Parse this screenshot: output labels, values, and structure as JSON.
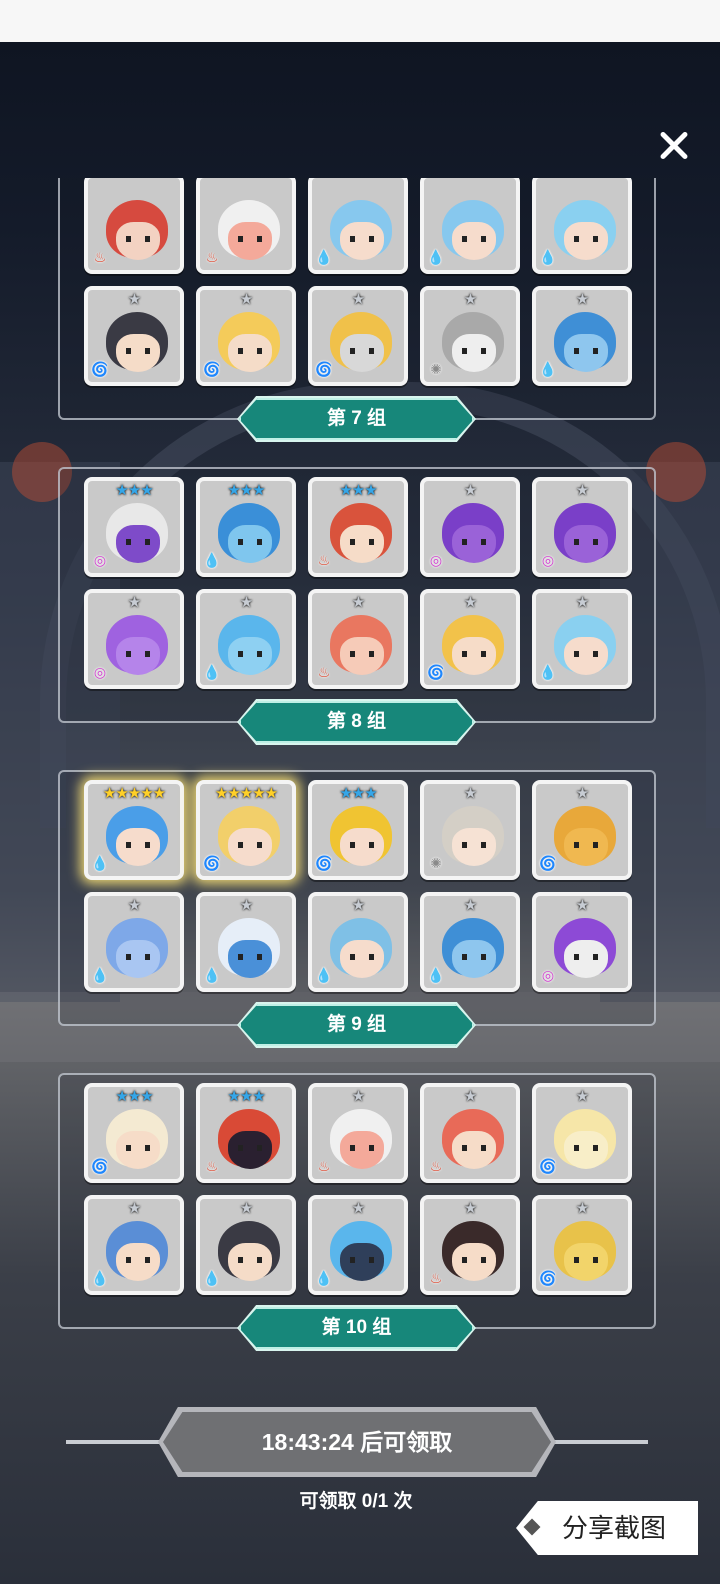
{
  "groups": [
    {
      "label": "第 7 组",
      "heroes": [
        {
          "stars": "",
          "tier": "grey",
          "element": "fire",
          "hair": "#d64a3f",
          "skin": "#f3d2c2"
        },
        {
          "stars": "",
          "tier": "grey",
          "element": "fire",
          "hair": "#f0f0f0",
          "skin": "#f4a99a"
        },
        {
          "stars": "",
          "tier": "grey",
          "element": "water",
          "hair": "#87c8ee",
          "skin": "#f6dccc"
        },
        {
          "stars": "",
          "tier": "grey",
          "element": "water",
          "hair": "#87c8ee",
          "skin": "#f6dccc"
        },
        {
          "stars": "",
          "tier": "grey",
          "element": "water",
          "hair": "#8ad0f0",
          "skin": "#f6dccc"
        },
        {
          "stars": "★",
          "tier": "grey",
          "element": "wind",
          "hair": "#3a3a44",
          "skin": "#f5dcc8"
        },
        {
          "stars": "★",
          "tier": "grey",
          "element": "wind",
          "hair": "#f4cb5a",
          "skin": "#f5dcc8"
        },
        {
          "stars": "★",
          "tier": "grey",
          "element": "wind",
          "hair": "#f0c14a",
          "skin": "#d8d8d8"
        },
        {
          "stars": "★",
          "tier": "grey",
          "element": "light",
          "hair": "#a9a9a9",
          "skin": "#eeeeee"
        },
        {
          "stars": "★",
          "tier": "grey",
          "element": "water",
          "hair": "#3f8fd6",
          "skin": "#8ec6ee"
        }
      ]
    },
    {
      "label": "第 8 组",
      "heroes": [
        {
          "stars": "★★★",
          "tier": "blue",
          "element": "dark",
          "hair": "#e8e8e8",
          "skin": "#7e4bc9"
        },
        {
          "stars": "★★★",
          "tier": "blue",
          "element": "water",
          "hair": "#3a8fd8",
          "skin": "#7fc6ee"
        },
        {
          "stars": "★★★",
          "tier": "blue",
          "element": "fire",
          "hair": "#d9533c",
          "skin": "#f6dcc8"
        },
        {
          "stars": "★",
          "tier": "grey",
          "element": "dark",
          "hair": "#7a3fc8",
          "skin": "#9a62d8"
        },
        {
          "stars": "★",
          "tier": "grey",
          "element": "dark",
          "hair": "#7a3fc8",
          "skin": "#9a62d8"
        },
        {
          "stars": "★",
          "tier": "grey",
          "element": "dark",
          "hair": "#9f62e0",
          "skin": "#b584ea"
        },
        {
          "stars": "★",
          "tier": "grey",
          "element": "water",
          "hair": "#5ab6ec",
          "skin": "#8ed0f2"
        },
        {
          "stars": "★",
          "tier": "grey",
          "element": "fire",
          "hair": "#e97760",
          "skin": "#f6cbb8"
        },
        {
          "stars": "★",
          "tier": "grey",
          "element": "wind",
          "hair": "#f2c24a",
          "skin": "#f6dcc8"
        },
        {
          "stars": "★",
          "tier": "grey",
          "element": "water",
          "hair": "#8ad0f0",
          "skin": "#f6dccc"
        }
      ]
    },
    {
      "label": "第 9 组",
      "heroes": [
        {
          "stars": "★★★★★",
          "tier": "gold",
          "element": "water",
          "hair": "#4a9ee8",
          "skin": "#f6dccc",
          "glow": true
        },
        {
          "stars": "★★★★★",
          "tier": "gold",
          "element": "wind",
          "hair": "#f2cf6a",
          "skin": "#f6dccc",
          "glow": true
        },
        {
          "stars": "★★★",
          "tier": "blue",
          "element": "wind",
          "hair": "#f0c432",
          "skin": "#f6dccc"
        },
        {
          "stars": "★",
          "tier": "grey",
          "element": "light",
          "hair": "#d4cfc6",
          "skin": "#f6e2d4"
        },
        {
          "stars": "★",
          "tier": "grey",
          "element": "wind",
          "hair": "#e8a83a",
          "skin": "#f0b850"
        },
        {
          "stars": "★",
          "tier": "grey",
          "element": "water",
          "hair": "#7ea8e8",
          "skin": "#a9c6f2"
        },
        {
          "stars": "★",
          "tier": "grey",
          "element": "water",
          "hair": "#e6eef8",
          "skin": "#4a90d8"
        },
        {
          "stars": "★",
          "tier": "grey",
          "element": "water",
          "hair": "#7fc0e6",
          "skin": "#f6dccc"
        },
        {
          "stars": "★",
          "tier": "grey",
          "element": "water",
          "hair": "#3f8fd6",
          "skin": "#8ec6ee"
        },
        {
          "stars": "★",
          "tier": "grey",
          "element": "dark",
          "hair": "#8d4ad6",
          "skin": "#eeeeee"
        }
      ]
    },
    {
      "label": "第 10 组",
      "heroes": [
        {
          "stars": "★★★",
          "tier": "blue",
          "element": "wind",
          "hair": "#f4ead2",
          "skin": "#f6dcc8"
        },
        {
          "stars": "★★★",
          "tier": "blue",
          "element": "fire",
          "hair": "#d94a36",
          "skin": "#2a2030"
        },
        {
          "stars": "★",
          "tier": "grey",
          "element": "fire",
          "hair": "#f0f0f0",
          "skin": "#f4a99a"
        },
        {
          "stars": "★",
          "tier": "grey",
          "element": "fire",
          "hair": "#e86a58",
          "skin": "#f6dcc8"
        },
        {
          "stars": "★",
          "tier": "grey",
          "element": "wind",
          "hair": "#f6e6a8",
          "skin": "#f8eec8"
        },
        {
          "stars": "★",
          "tier": "grey",
          "element": "water",
          "hair": "#5a8ed6",
          "skin": "#f6dcc8"
        },
        {
          "stars": "★",
          "tier": "grey",
          "element": "water",
          "hair": "#3a3a44",
          "skin": "#f5dcc8"
        },
        {
          "stars": "★",
          "tier": "grey",
          "element": "water",
          "hair": "#5ab6ec",
          "skin": "#2f3f5a"
        },
        {
          "stars": "★",
          "tier": "grey",
          "element": "fire",
          "hair": "#3a2a2a",
          "skin": "#f6dcc8"
        },
        {
          "stars": "★",
          "tier": "grey",
          "element": "wind",
          "hair": "#e8c24a",
          "skin": "#f2d46a"
        }
      ]
    }
  ],
  "element_glyphs": {
    "fire": "♨",
    "water": "💧",
    "wind": "🌀",
    "dark": "◎",
    "light": "✺"
  },
  "claim": {
    "button_label": "18:43:24 后可领取",
    "count_text": "可领取 0/1 次"
  },
  "share": {
    "label": "分享截图"
  },
  "icons": {
    "close": "close-icon",
    "share": "share-diamond-icon"
  }
}
